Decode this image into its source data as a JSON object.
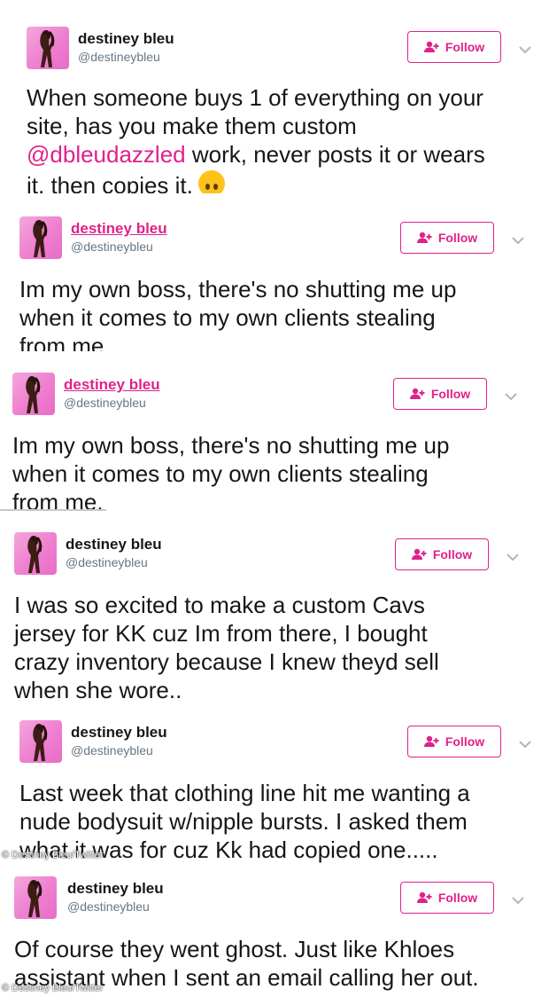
{
  "follow_label": "Follow",
  "accent_color": "#e0218a",
  "tweets": [
    {
      "name": "destiney bleu",
      "handle": "@destineybleu",
      "text_lines": [
        "When someone buys 1 of everything on your",
        "site, has you make them custom",
        "it, then copies it."
      ],
      "mention": "@dbleudazzled",
      "mention_suffix": " work, never posts it or wears",
      "emoji": "upside-down-face"
    },
    {
      "name": "destiney bleu",
      "handle": "@destineybleu",
      "text_lines": [
        "Im my own boss, there's no shutting me up",
        "when it comes to my own clients stealing",
        "from me."
      ]
    },
    {
      "name": "destiney bleu",
      "handle": "@destineybleu",
      "text_lines": [
        "Im my own boss, there's no shutting me up",
        "when it comes to my own clients stealing",
        "from me."
      ]
    },
    {
      "name": "destiney bleu",
      "handle": "@destineybleu",
      "text_lines": [
        "I was so excited to make a custom Cavs",
        "jersey for KK cuz Im from there, I bought",
        "crazy inventory because I knew theyd sell",
        "when she wore.."
      ]
    },
    {
      "name": "destiney bleu",
      "handle": "@destineybleu",
      "text_lines": [
        "Last week that clothing line hit me wanting a",
        "nude bodysuit w/nipple bursts. I asked them",
        "what it was for cuz Kk had copied one....."
      ]
    },
    {
      "name": "destiney bleu",
      "handle": "@destineybleu",
      "text_lines": [
        "Of course they went ghost. Just like Khloes",
        "assistant when I sent an email calling her out."
      ]
    }
  ],
  "watermarks": [
    "© Destiney Bleu/Twitter",
    "© Destiney Bleu/Twitter"
  ],
  "icons": {
    "follow": "add-user-icon",
    "caret": "chevron-down-icon",
    "avatar": "profile-photo"
  }
}
